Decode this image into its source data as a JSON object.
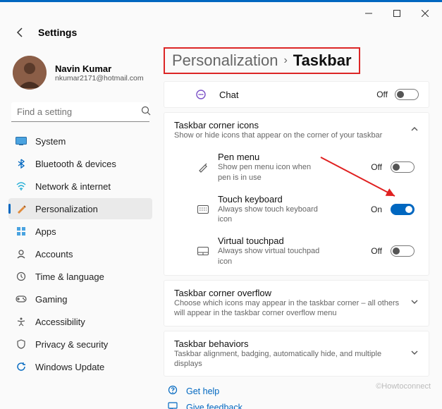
{
  "window": {
    "app_title": "Settings"
  },
  "user": {
    "name": "Navin Kumar",
    "email": "nkumar2171@hotmail.com"
  },
  "search": {
    "placeholder": "Find a setting"
  },
  "nav": {
    "items": [
      {
        "label": "System"
      },
      {
        "label": "Bluetooth & devices"
      },
      {
        "label": "Network & internet"
      },
      {
        "label": "Personalization"
      },
      {
        "label": "Apps"
      },
      {
        "label": "Accounts"
      },
      {
        "label": "Time & language"
      },
      {
        "label": "Gaming"
      },
      {
        "label": "Accessibility"
      },
      {
        "label": "Privacy & security"
      },
      {
        "label": "Windows Update"
      }
    ]
  },
  "breadcrumb": {
    "parent": "Personalization",
    "current": "Taskbar"
  },
  "chat": {
    "label": "Chat",
    "state": "Off"
  },
  "corner_icons": {
    "title": "Taskbar corner icons",
    "desc": "Show or hide icons that appear on the corner of your taskbar",
    "items": [
      {
        "title": "Pen menu",
        "desc": "Show pen menu icon when pen is in use",
        "state": "Off",
        "on": false
      },
      {
        "title": "Touch keyboard",
        "desc": "Always show touch keyboard icon",
        "state": "On",
        "on": true
      },
      {
        "title": "Virtual touchpad",
        "desc": "Always show virtual touchpad icon",
        "state": "Off",
        "on": false
      }
    ]
  },
  "overflow": {
    "title": "Taskbar corner overflow",
    "desc": "Choose which icons may appear in the taskbar corner – all others will appear in the taskbar corner overflow menu"
  },
  "behaviors": {
    "title": "Taskbar behaviors",
    "desc": "Taskbar alignment, badging, automatically hide, and multiple displays"
  },
  "help": {
    "get_help": "Get help",
    "give_feedback": "Give feedback"
  },
  "watermark": "©Howtoconnect"
}
